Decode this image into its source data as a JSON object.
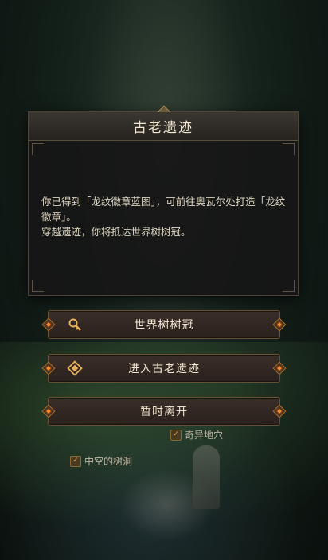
{
  "dialog": {
    "title": "古老遗迹",
    "body_line1": "你已得到「龙纹徽章蓝图」，可前往奥瓦尔处打造「龙纹徽章」。",
    "body_line2": "穿越遗迹，你将抵达世界树树冠。"
  },
  "options": [
    {
      "label": "世界树树冠",
      "icon": "key-icon"
    },
    {
      "label": "进入古老遗迹",
      "icon": "ruins-emblem-icon"
    },
    {
      "label": "暂时离开",
      "icon": ""
    }
  ],
  "map_labels": [
    {
      "label": "奇异地穴",
      "checked": true
    },
    {
      "label": "中空的树洞",
      "checked": true
    }
  ],
  "colors": {
    "accent_orange": "#ff8a2a",
    "gold": "#e8b25a"
  }
}
